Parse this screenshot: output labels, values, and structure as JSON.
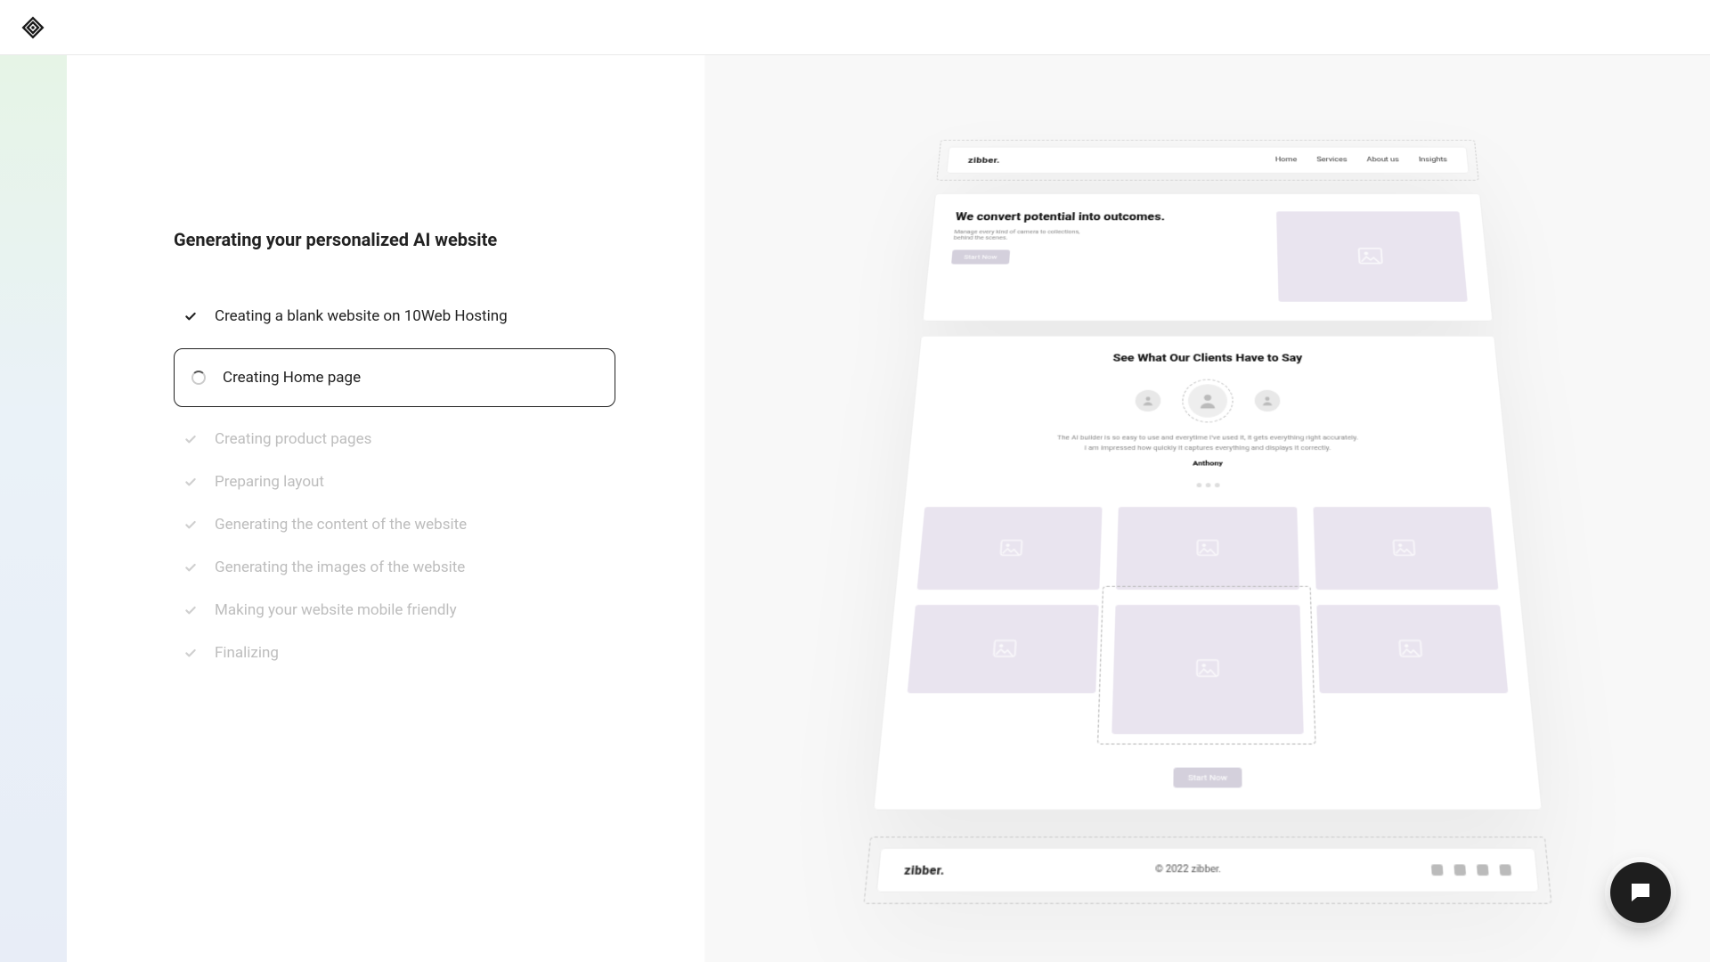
{
  "heading": "Generating your personalized AI website",
  "steps": [
    {
      "label": "Creating a blank website on 10Web Hosting",
      "state": "done"
    },
    {
      "label": "Creating Home page",
      "state": "active"
    },
    {
      "label": "Creating product pages",
      "state": "pending"
    },
    {
      "label": "Preparing layout",
      "state": "pending"
    },
    {
      "label": "Generating the content of the website",
      "state": "pending"
    },
    {
      "label": "Generating the images of the website",
      "state": "pending"
    },
    {
      "label": "Making your website mobile friendly",
      "state": "pending"
    },
    {
      "label": "Finalizing",
      "state": "pending"
    }
  ],
  "preview": {
    "brand": "zibber.",
    "nav": [
      "Home",
      "Services",
      "About us",
      "Insights"
    ],
    "hero_title": "We convert potential into outcomes.",
    "hero_sub": "Manage every kind of camera to collections, behind the scenes.",
    "hero_btn": "Start Now",
    "testimonials_title": "See What Our Clients Have to Say",
    "quote_line1": "The AI builder is so easy to use and everytime I've used it, it gets everything right accurately.",
    "quote_line2": "I am impressed how quickly it captures everything and displays it correctly.",
    "author": "Anthony",
    "cta_btn": "Start Now",
    "footer_brand": "zibber.",
    "copyright": "© 2022 zibber."
  }
}
